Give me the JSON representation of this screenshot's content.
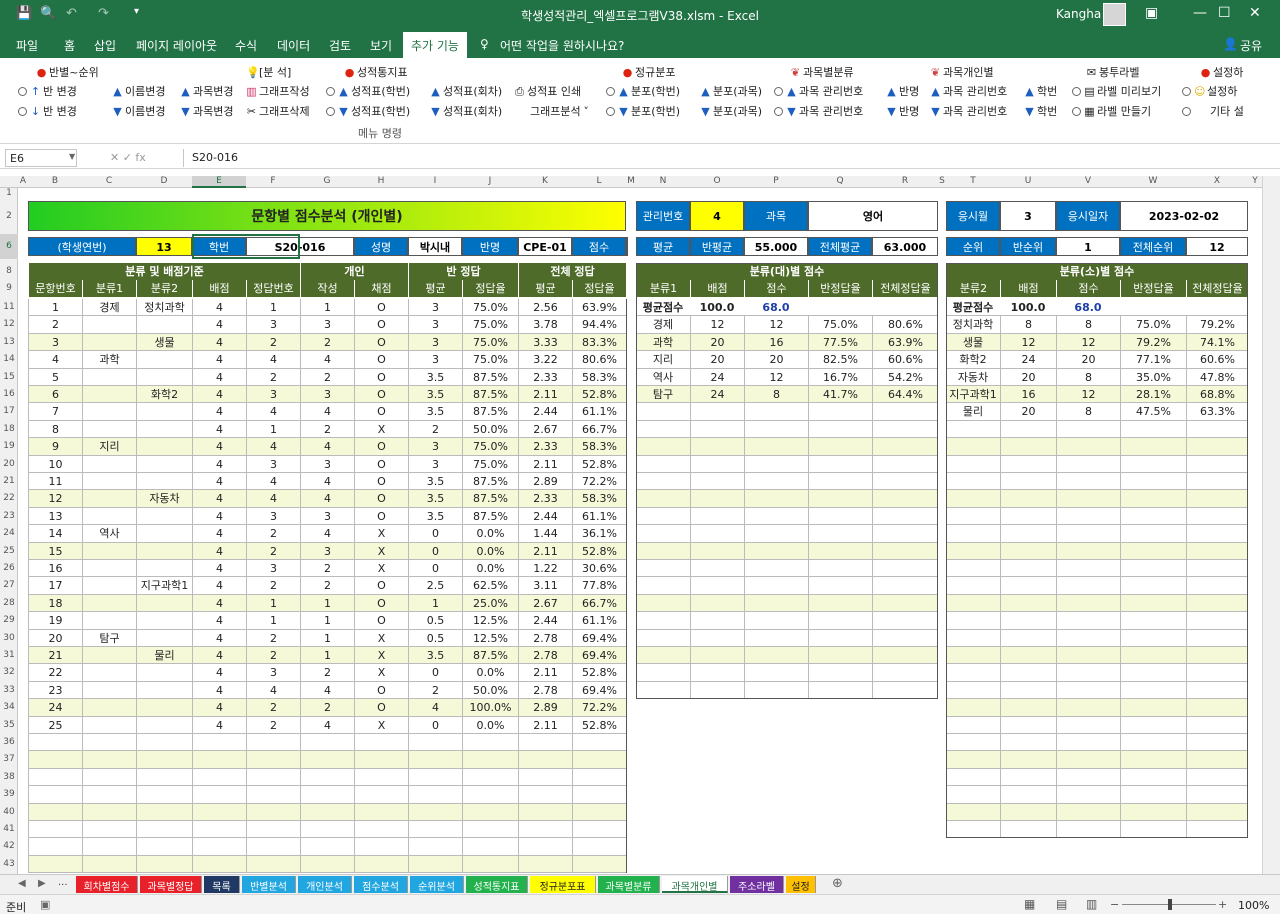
{
  "window": {
    "title": "학생성적관리_엑셀프로그램V38.xlsm  -  Excel",
    "user": "Kangha"
  },
  "tabs": [
    "파일",
    "홈",
    "삽입",
    "페이지 레이아웃",
    "수식",
    "데이터",
    "검토",
    "보기",
    "추가 기능"
  ],
  "tell_me": "어떤 작업을 원하시나요?",
  "share": "공유",
  "ribbon": {
    "group_label": "메뉴 명령",
    "items": [
      {
        "t": "반별~순위",
        "icon": "pin-icon"
      },
      {
        "t": "반 변경",
        "icon": "arrow-up-icon"
      },
      {
        "t": "반 변경",
        "icon": "arrow-down-icon"
      },
      {
        "t": "이름변경",
        "icon": "triangle-up-icon"
      },
      {
        "t": "과목변경",
        "icon": "triangle-up-icon"
      },
      {
        "t": "이름변경",
        "icon": "triangle-down-icon"
      },
      {
        "t": "과목변경",
        "icon": "triangle-down-icon"
      },
      {
        "t": "[분 석]",
        "icon": "bulb-icon"
      },
      {
        "t": "그래프작성",
        "icon": "chart-icon"
      },
      {
        "t": "그래프삭제",
        "icon": "scissors-icon"
      },
      {
        "t": "성적통지표",
        "icon": "pin-icon"
      },
      {
        "t": "성적표(학번)",
        "icon": "triangle-up-icon"
      },
      {
        "t": "성적표(회차)",
        "icon": "triangle-up-icon"
      },
      {
        "t": "성적표 인쇄",
        "icon": "printer-icon"
      },
      {
        "t": "성적표(학번)",
        "icon": "triangle-down-icon"
      },
      {
        "t": "성적표(회차)",
        "icon": "triangle-down-icon"
      },
      {
        "t": "그래프분석",
        "icon": "dropdown-icon"
      },
      {
        "t": "정규분포",
        "icon": "pin-icon"
      },
      {
        "t": "분포(학번)",
        "icon": "triangle-up-icon"
      },
      {
        "t": "분포(과목)",
        "icon": "triangle-up-icon"
      },
      {
        "t": "분포(학번)",
        "icon": "triangle-down-icon"
      },
      {
        "t": "분포(과목)",
        "icon": "triangle-down-icon"
      },
      {
        "t": "과목별분류",
        "icon": "butterfly-icon"
      },
      {
        "t": "과목 관리번호",
        "icon": "triangle-up-icon"
      },
      {
        "t": "반명",
        "icon": "triangle-up-icon"
      },
      {
        "t": "과목 관리번호",
        "icon": "triangle-down-icon"
      },
      {
        "t": "반명",
        "icon": "triangle-down-icon"
      },
      {
        "t": "과목개인별",
        "icon": "butterfly-icon"
      },
      {
        "t": "과목 관리번호",
        "icon": "triangle-up-icon"
      },
      {
        "t": "학번",
        "icon": "triangle-up-icon"
      },
      {
        "t": "과목 관리번호",
        "icon": "triangle-down-icon"
      },
      {
        "t": "학번",
        "icon": "triangle-down-icon"
      },
      {
        "t": "봉투라벨",
        "icon": "envelope-icon"
      },
      {
        "t": "라벨 미리보기",
        "icon": "preview-icon"
      },
      {
        "t": "라벨 만들기",
        "icon": "grid-icon"
      },
      {
        "t": "설정하",
        "icon": "pin-icon"
      },
      {
        "t": "설정하",
        "icon": "smiley-icon"
      },
      {
        "t": "기타 설",
        "icon": ""
      }
    ]
  },
  "formula": {
    "name_box": "E6",
    "value": "S20-016"
  },
  "col_letters": [
    "A",
    "B",
    "C",
    "D",
    "E",
    "F",
    "G",
    "H",
    "I",
    "J",
    "K",
    "L",
    "M",
    "N",
    "O",
    "P",
    "Q",
    "R",
    "S",
    "T",
    "U",
    "V",
    "W",
    "X",
    "Y"
  ],
  "sheet": {
    "title": "문항별 점수분석 (개인별)",
    "info": {
      "label_year": "(학생연번)",
      "year": "13",
      "label_id": "학번",
      "id": "S20-016",
      "label_name": "성명",
      "name": "박시내",
      "label_class": "반명",
      "class": "CPE-01",
      "label_score": "점수",
      "score": "68.0"
    },
    "mgmt": {
      "label_no": "관리번호",
      "no": "4",
      "label_subject": "과목",
      "subject": "영어",
      "label_avg": "평균",
      "label_classavg": "반평균",
      "classavg": "55.000",
      "label_totalavg": "전체평균",
      "totalavg": "63.000"
    },
    "exam": {
      "label_month": "응시월",
      "month": "3",
      "label_date": "응시일자",
      "date": "2023-02-02",
      "label_rank": "순위",
      "label_classrank": "반순위",
      "classrank": "1",
      "label_totalrank": "전체순위",
      "totalrank": "12"
    },
    "main_group_headers": [
      "분류 및 배점기준",
      "개인",
      "반 정답",
      "전체 정답"
    ],
    "main_headers": [
      "문항번호",
      "분류1",
      "분류2",
      "배점",
      "정답번호",
      "작성",
      "채점",
      "평균",
      "정답율",
      "평균",
      "정답율"
    ],
    "main_rows": [
      [
        "1",
        "경제",
        "정치과학",
        "4",
        "1",
        "1",
        "O",
        "3",
        "75.0%",
        "2.56",
        "63.9%"
      ],
      [
        "2",
        "",
        "",
        "4",
        "3",
        "3",
        "O",
        "3",
        "75.0%",
        "3.78",
        "94.4%"
      ],
      [
        "3",
        "",
        "생물",
        "4",
        "2",
        "2",
        "O",
        "3",
        "75.0%",
        "3.33",
        "83.3%"
      ],
      [
        "4",
        "과학",
        "",
        "4",
        "4",
        "4",
        "O",
        "3",
        "75.0%",
        "3.22",
        "80.6%"
      ],
      [
        "5",
        "",
        "",
        "4",
        "2",
        "2",
        "O",
        "3.5",
        "87.5%",
        "2.33",
        "58.3%"
      ],
      [
        "6",
        "",
        "화학2",
        "4",
        "3",
        "3",
        "O",
        "3.5",
        "87.5%",
        "2.11",
        "52.8%"
      ],
      [
        "7",
        "",
        "",
        "4",
        "4",
        "4",
        "O",
        "3.5",
        "87.5%",
        "2.44",
        "61.1%"
      ],
      [
        "8",
        "",
        "",
        "4",
        "1",
        "2",
        "X",
        "2",
        "50.0%",
        "2.67",
        "66.7%"
      ],
      [
        "9",
        "지리",
        "",
        "4",
        "4",
        "4",
        "O",
        "3",
        "75.0%",
        "2.33",
        "58.3%"
      ],
      [
        "10",
        "",
        "",
        "4",
        "3",
        "3",
        "O",
        "3",
        "75.0%",
        "2.11",
        "52.8%"
      ],
      [
        "11",
        "",
        "",
        "4",
        "4",
        "4",
        "O",
        "3.5",
        "87.5%",
        "2.89",
        "72.2%"
      ],
      [
        "12",
        "",
        "자동차",
        "4",
        "4",
        "4",
        "O",
        "3.5",
        "87.5%",
        "2.33",
        "58.3%"
      ],
      [
        "13",
        "",
        "",
        "4",
        "3",
        "3",
        "O",
        "3.5",
        "87.5%",
        "2.44",
        "61.1%"
      ],
      [
        "14",
        "역사",
        "",
        "4",
        "2",
        "4",
        "X",
        "0",
        "0.0%",
        "1.44",
        "36.1%"
      ],
      [
        "15",
        "",
        "",
        "4",
        "2",
        "3",
        "X",
        "0",
        "0.0%",
        "2.11",
        "52.8%"
      ],
      [
        "16",
        "",
        "",
        "4",
        "3",
        "2",
        "X",
        "0",
        "0.0%",
        "1.22",
        "30.6%"
      ],
      [
        "17",
        "",
        "지구과학1",
        "4",
        "2",
        "2",
        "O",
        "2.5",
        "62.5%",
        "3.11",
        "77.8%"
      ],
      [
        "18",
        "",
        "",
        "4",
        "1",
        "1",
        "O",
        "1",
        "25.0%",
        "2.67",
        "66.7%"
      ],
      [
        "19",
        "",
        "",
        "4",
        "1",
        "1",
        "O",
        "0.5",
        "12.5%",
        "2.44",
        "61.1%"
      ],
      [
        "20",
        "탐구",
        "",
        "4",
        "2",
        "1",
        "X",
        "0.5",
        "12.5%",
        "2.78",
        "69.4%"
      ],
      [
        "21",
        "",
        "물리",
        "4",
        "2",
        "1",
        "X",
        "3.5",
        "87.5%",
        "2.78",
        "69.4%"
      ],
      [
        "22",
        "",
        "",
        "4",
        "3",
        "2",
        "X",
        "0",
        "0.0%",
        "2.11",
        "52.8%"
      ],
      [
        "23",
        "",
        "",
        "4",
        "4",
        "4",
        "O",
        "2",
        "50.0%",
        "2.78",
        "69.4%"
      ],
      [
        "24",
        "",
        "",
        "4",
        "2",
        "2",
        "O",
        "4",
        "100.0%",
        "2.89",
        "72.2%"
      ],
      [
        "25",
        "",
        "",
        "4",
        "2",
        "4",
        "X",
        "0",
        "0.0%",
        "2.11",
        "52.8%"
      ]
    ],
    "big_header": "분류(대)별 점수",
    "big_cols": [
      "분류1",
      "배점",
      "점수",
      "반정답율",
      "전체정답율"
    ],
    "big_avg": {
      "label": "평균점수",
      "total": "100.0",
      "score": "68.0"
    },
    "big_rows": [
      [
        "경제",
        "12",
        "12",
        "75.0%",
        "80.6%"
      ],
      [
        "과학",
        "20",
        "16",
        "77.5%",
        "63.9%"
      ],
      [
        "지리",
        "20",
        "20",
        "82.5%",
        "60.6%"
      ],
      [
        "역사",
        "24",
        "12",
        "16.7%",
        "54.2%"
      ],
      [
        "탐구",
        "24",
        "8",
        "41.7%",
        "64.4%"
      ]
    ],
    "small_header": "분류(소)별 점수",
    "small_cols": [
      "분류2",
      "배점",
      "점수",
      "반정답율",
      "전체정답율"
    ],
    "small_avg": {
      "label": "평균점수",
      "total": "100.0",
      "score": "68.0"
    },
    "small_rows": [
      [
        "정치과학",
        "8",
        "8",
        "75.0%",
        "79.2%"
      ],
      [
        "생물",
        "12",
        "12",
        "79.2%",
        "74.1%"
      ],
      [
        "화학2",
        "24",
        "20",
        "77.1%",
        "60.6%"
      ],
      [
        "자동차",
        "20",
        "8",
        "35.0%",
        "47.8%"
      ],
      [
        "지구과학1",
        "16",
        "12",
        "28.1%",
        "68.8%"
      ],
      [
        "물리",
        "20",
        "8",
        "47.5%",
        "63.3%"
      ]
    ]
  },
  "sheet_tabs": [
    {
      "t": "회차별점수",
      "c": "#e8202a"
    },
    {
      "t": "과목별정답",
      "c": "#e8202a"
    },
    {
      "t": "목록",
      "c": "#1f3864"
    },
    {
      "t": "반별분석",
      "c": "#22a6e0"
    },
    {
      "t": "개인분석",
      "c": "#22a6e0"
    },
    {
      "t": "점수분석",
      "c": "#22a6e0"
    },
    {
      "t": "순위분석",
      "c": "#22a6e0"
    },
    {
      "t": "성적통지표",
      "c": "#22b14c"
    },
    {
      "t": "정규분포표",
      "c": "#ffff00"
    },
    {
      "t": "과목별분류",
      "c": "#22b14c"
    },
    {
      "t": "과목개인별",
      "c": "#ffffff"
    },
    {
      "t": "주소라벨",
      "c": "#7030a0"
    },
    {
      "t": "설정",
      "c": "#ffc000"
    }
  ],
  "status": {
    "ready": "준비",
    "zoom": "100%"
  },
  "colors": {
    "excel_green": "#217346",
    "title_gradient_start": "#22cc22",
    "title_gradient_end": "#ffff00",
    "header_olive": "#4e6b2a",
    "label_blue": "#0070c0",
    "yellow": "#ffff00",
    "stripe": "#f6f9d8"
  }
}
